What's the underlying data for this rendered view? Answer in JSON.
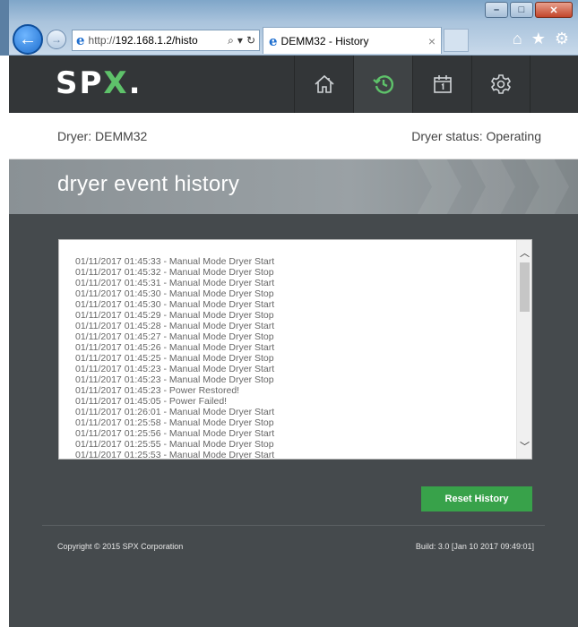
{
  "browser": {
    "url": "http://192.168.1.2/histo",
    "url_proto": "http://",
    "url_host": "192.168.1.2/histo",
    "tab_title": "DEMM32 - History"
  },
  "app": {
    "logo_main": "SP",
    "logo_accent": "X",
    "logo_dot": "."
  },
  "nav": [
    {
      "name": "home",
      "icon": "home-icon",
      "active": false
    },
    {
      "name": "history",
      "icon": "history-icon",
      "active": true
    },
    {
      "name": "calendar",
      "icon": "calendar-icon",
      "active": false
    },
    {
      "name": "settings",
      "icon": "gear-icon",
      "active": false
    }
  ],
  "status": {
    "dryer": "Dryer: DEMM32",
    "dryer_status": "Dryer status: Operating"
  },
  "page": {
    "title": "dryer event history"
  },
  "log": {
    "lines": [
      "01/11/2017 01:45:33 - Manual Mode Dryer Start",
      "01/11/2017 01:45:32 - Manual Mode Dryer Stop",
      "01/11/2017 01:45:31 - Manual Mode Dryer Start",
      "01/11/2017 01:45:30 - Manual Mode Dryer Stop",
      "01/11/2017 01:45:30 - Manual Mode Dryer Start",
      "01/11/2017 01:45:29 - Manual Mode Dryer Stop",
      "01/11/2017 01:45:28 - Manual Mode Dryer Start",
      "01/11/2017 01:45:27 - Manual Mode Dryer Stop",
      "01/11/2017 01:45:26 - Manual Mode Dryer Start",
      "01/11/2017 01:45:25 - Manual Mode Dryer Stop",
      "01/11/2017 01:45:23 - Manual Mode Dryer Start",
      "01/11/2017 01:45:23 - Manual Mode Dryer Stop",
      "01/11/2017 01:45:23 - Power Restored!",
      "01/11/2017 01:45:05 - Power Failed!",
      "01/11/2017 01:26:01 - Manual Mode Dryer Start",
      "01/11/2017 01:25:58 - Manual Mode Dryer Stop",
      "01/11/2017 01:25:56 - Manual Mode Dryer Start",
      "01/11/2017 01:25:55 - Manual Mode Dryer Stop",
      "01/11/2017 01:25:53 - Manual Mode Dryer Start"
    ]
  },
  "actions": {
    "reset_label": "Reset History"
  },
  "footer": {
    "copyright": "Copyright © 2015 SPX Corporation",
    "build": "Build: 3.0 [Jan 10 2017 09:49:01]"
  },
  "colors": {
    "accent_green": "#38a24a",
    "header_bg": "#333638",
    "main_bg": "#454a4d"
  }
}
